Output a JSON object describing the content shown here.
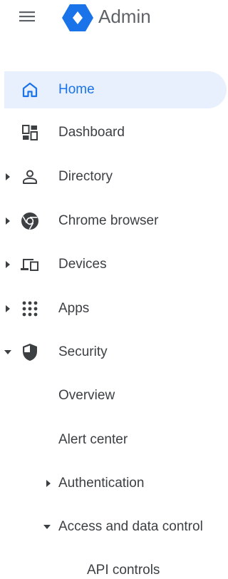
{
  "header": {
    "app_title": "Admin",
    "menu_icon": "hamburger-menu-icon",
    "logo_icon": "admin-logo-icon",
    "brand_color": "#1a73e8"
  },
  "sidebar": {
    "items": [
      {
        "label": "Home",
        "icon": "home-icon",
        "active": true,
        "expandable": false
      },
      {
        "label": "Dashboard",
        "icon": "dashboard-icon",
        "active": false,
        "expandable": false
      },
      {
        "label": "Directory",
        "icon": "person-icon",
        "active": false,
        "expandable": true,
        "expanded": false
      },
      {
        "label": "Chrome browser",
        "icon": "chrome-icon",
        "active": false,
        "expandable": true,
        "expanded": false
      },
      {
        "label": "Devices",
        "icon": "devices-icon",
        "active": false,
        "expandable": true,
        "expanded": false
      },
      {
        "label": "Apps",
        "icon": "apps-grid-icon",
        "active": false,
        "expandable": true,
        "expanded": false
      },
      {
        "label": "Security",
        "icon": "shield-icon",
        "active": false,
        "expandable": true,
        "expanded": true
      }
    ],
    "security_children": [
      {
        "label": "Overview",
        "expandable": false
      },
      {
        "label": "Alert center",
        "expandable": false
      },
      {
        "label": "Authentication",
        "expandable": true,
        "expanded": false
      },
      {
        "label": "Access and data control",
        "expandable": true,
        "expanded": true
      }
    ],
    "access_children": [
      {
        "label": "API controls"
      }
    ],
    "active_bg_color": "#e8f0fe",
    "active_text_color": "#1a73e8"
  }
}
